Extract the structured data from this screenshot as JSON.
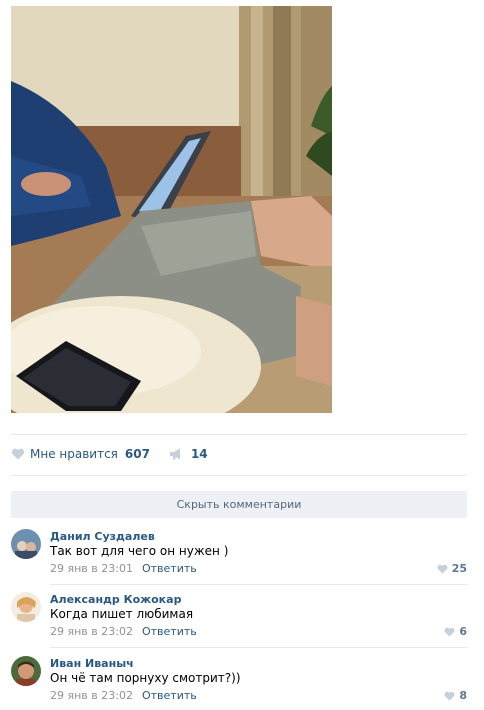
{
  "post": {
    "like_label": "Мне нравится",
    "like_count": "607",
    "share_count": "14",
    "hide_comments_label": "Скрыть комментарии"
  },
  "comments": [
    {
      "author": "Данил Суздалев",
      "text": "Так вот для чего он нужен )",
      "date": "29 янв в 23:01",
      "reply": "Ответить",
      "likes": "25"
    },
    {
      "author": "Александр Кожокар",
      "text": "Когда пишет любимая",
      "date": "29 янв в 23:02",
      "reply": "Ответить",
      "likes": "6"
    },
    {
      "author": "Иван Иваныч",
      "text": "Он чё там порнуху смотрит?))",
      "date": "29 янв в 23:02",
      "reply": "Ответить",
      "likes": "8"
    }
  ],
  "icons": {
    "like": "heart-icon",
    "share": "megaphone-icon",
    "comment_like": "heart-icon"
  },
  "colors": {
    "link": "#2a5885",
    "muted": "#939393",
    "bar_bg": "#edf0f5",
    "heart": "#c5d0db"
  }
}
